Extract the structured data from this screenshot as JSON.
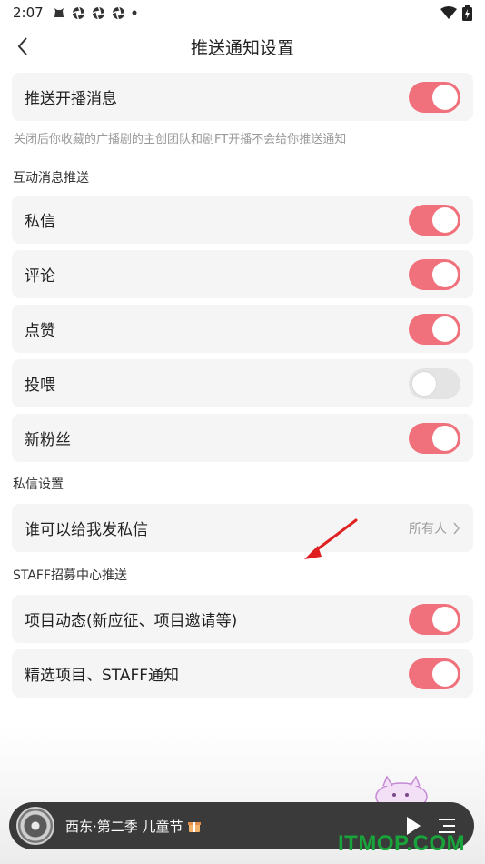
{
  "status_bar": {
    "time": "2:07",
    "icons": [
      "cat-icon",
      "aperture-icon",
      "aperture-icon",
      "aperture-icon",
      "dot-icon"
    ],
    "right_icons": [
      "wifi-icon",
      "battery-icon"
    ]
  },
  "header": {
    "title": "推送通知设置"
  },
  "main_push": {
    "label": "推送开播消息",
    "enabled": true,
    "hint": "关闭后你收藏的广播剧的主创团队和剧FT开播不会给你推送通知"
  },
  "interactive": {
    "title": "互动消息推送",
    "items": [
      {
        "label": "私信",
        "enabled": true
      },
      {
        "label": "评论",
        "enabled": true
      },
      {
        "label": "点赞",
        "enabled": true
      },
      {
        "label": "投喂",
        "enabled": false
      },
      {
        "label": "新粉丝",
        "enabled": true
      }
    ]
  },
  "dm_settings": {
    "title": "私信设置",
    "label": "谁可以给我发私信",
    "value": "所有人"
  },
  "staff": {
    "title": "STAFF招募中心推送",
    "items": [
      {
        "label": "项目动态(新应征、项目邀请等)",
        "enabled": true
      },
      {
        "label": "精选项目、STAFF通知",
        "enabled": true
      }
    ]
  },
  "player": {
    "track": "西东·第二季 儿童节"
  },
  "watermark": "ITMOP.COM",
  "colors": {
    "toggle_on": "#f0707b",
    "toggle_off": "#e4e4e4",
    "card_bg": "#f5f5f5"
  }
}
